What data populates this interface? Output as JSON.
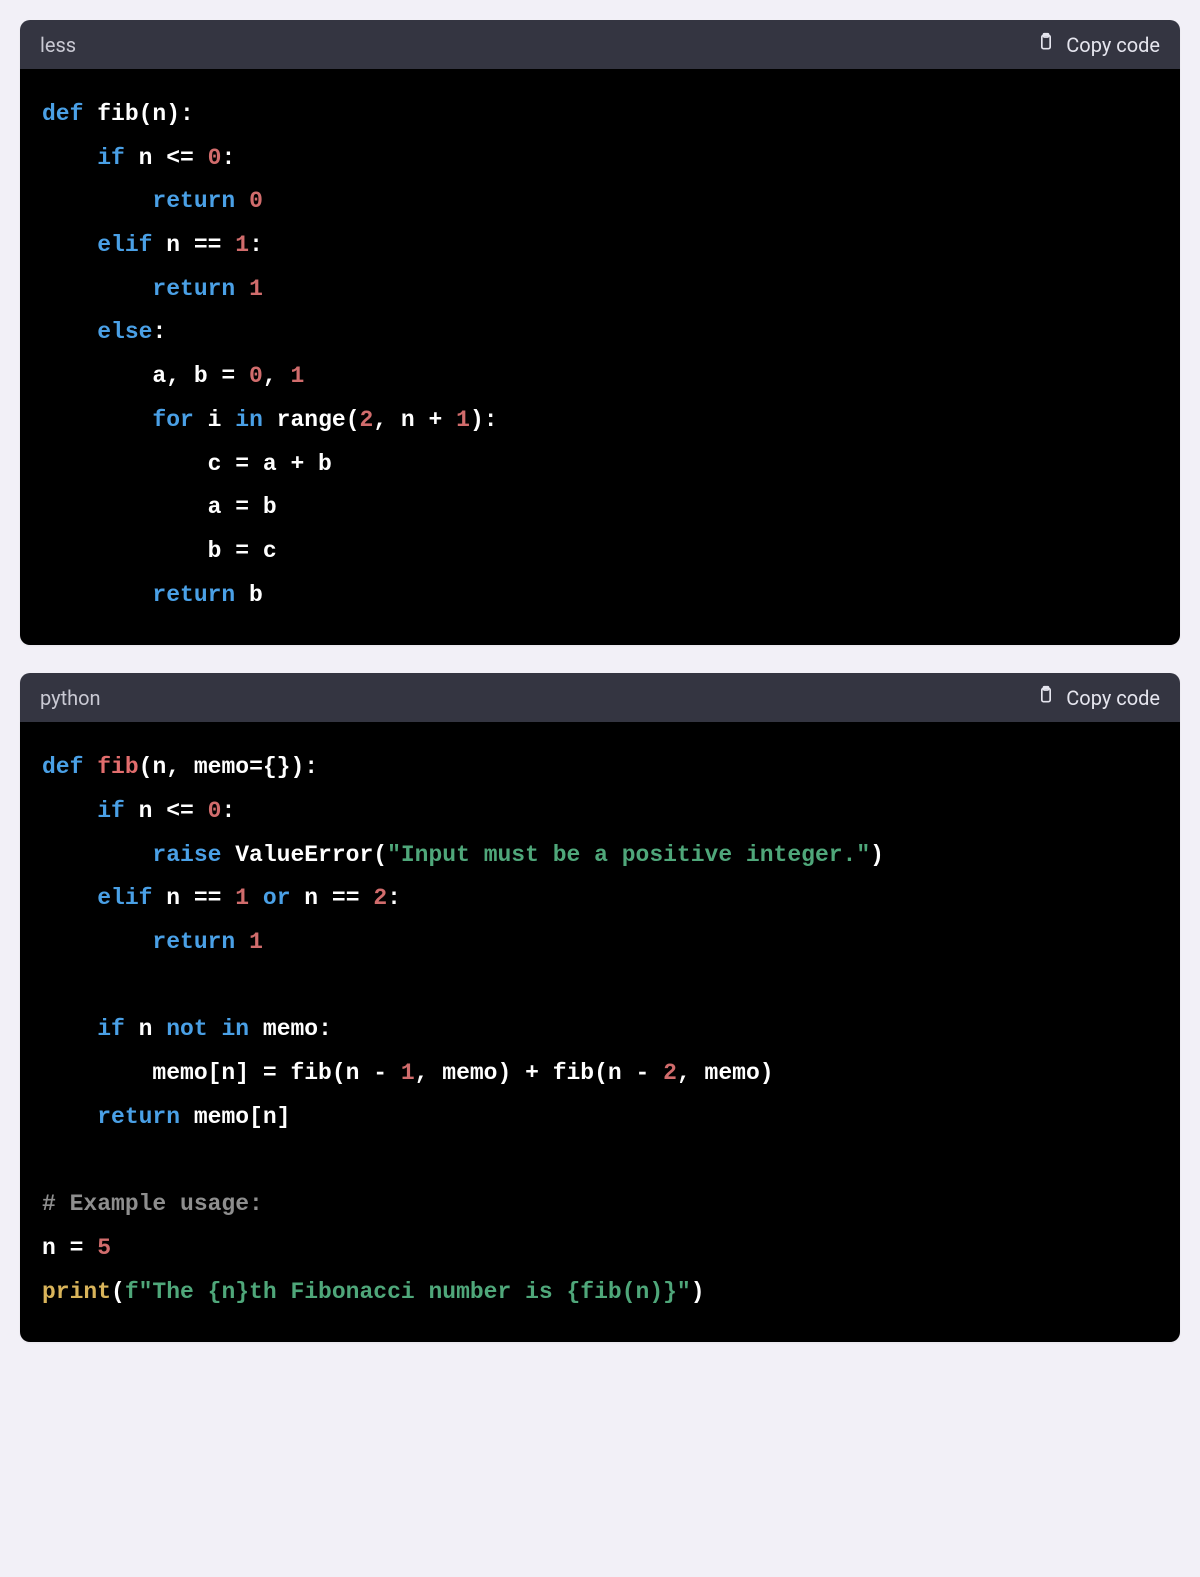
{
  "blocks": [
    {
      "language": "less",
      "copy_label": "Copy code",
      "code_tokens": [
        [
          {
            "c": "kw",
            "t": "def"
          },
          {
            "c": "plain",
            "t": " fib(n):"
          }
        ],
        [
          {
            "c": "plain",
            "t": "    "
          },
          {
            "c": "kw",
            "t": "if"
          },
          {
            "c": "plain",
            "t": " n <= "
          },
          {
            "c": "num",
            "t": "0"
          },
          {
            "c": "plain",
            "t": ":"
          }
        ],
        [
          {
            "c": "plain",
            "t": "        "
          },
          {
            "c": "kw",
            "t": "return"
          },
          {
            "c": "plain",
            "t": " "
          },
          {
            "c": "num",
            "t": "0"
          }
        ],
        [
          {
            "c": "plain",
            "t": "    "
          },
          {
            "c": "kw",
            "t": "elif"
          },
          {
            "c": "plain",
            "t": " n == "
          },
          {
            "c": "num",
            "t": "1"
          },
          {
            "c": "plain",
            "t": ":"
          }
        ],
        [
          {
            "c": "plain",
            "t": "        "
          },
          {
            "c": "kw",
            "t": "return"
          },
          {
            "c": "plain",
            "t": " "
          },
          {
            "c": "num",
            "t": "1"
          }
        ],
        [
          {
            "c": "plain",
            "t": "    "
          },
          {
            "c": "kw",
            "t": "else"
          },
          {
            "c": "plain",
            "t": ":"
          }
        ],
        [
          {
            "c": "plain",
            "t": "        a, b = "
          },
          {
            "c": "num",
            "t": "0"
          },
          {
            "c": "plain",
            "t": ", "
          },
          {
            "c": "num",
            "t": "1"
          }
        ],
        [
          {
            "c": "plain",
            "t": "        "
          },
          {
            "c": "kw",
            "t": "for"
          },
          {
            "c": "plain",
            "t": " i "
          },
          {
            "c": "kw",
            "t": "in"
          },
          {
            "c": "plain",
            "t": " range("
          },
          {
            "c": "num",
            "t": "2"
          },
          {
            "c": "plain",
            "t": ", n + "
          },
          {
            "c": "num",
            "t": "1"
          },
          {
            "c": "plain",
            "t": "):"
          }
        ],
        [
          {
            "c": "plain",
            "t": "            c = a + b"
          }
        ],
        [
          {
            "c": "plain",
            "t": "            a = b"
          }
        ],
        [
          {
            "c": "plain",
            "t": "            b = c"
          }
        ],
        [
          {
            "c": "plain",
            "t": "        "
          },
          {
            "c": "kw",
            "t": "return"
          },
          {
            "c": "plain",
            "t": " b"
          }
        ]
      ]
    },
    {
      "language": "python",
      "copy_label": "Copy code",
      "code_tokens": [
        [
          {
            "c": "kw",
            "t": "def"
          },
          {
            "c": "plain",
            "t": " "
          },
          {
            "c": "fn",
            "t": "fib"
          },
          {
            "c": "plain",
            "t": "(n, memo={}):"
          }
        ],
        [
          {
            "c": "plain",
            "t": "    "
          },
          {
            "c": "kw",
            "t": "if"
          },
          {
            "c": "plain",
            "t": " n <= "
          },
          {
            "c": "num",
            "t": "0"
          },
          {
            "c": "plain",
            "t": ":"
          }
        ],
        [
          {
            "c": "plain",
            "t": "        "
          },
          {
            "c": "kw",
            "t": "raise"
          },
          {
            "c": "plain",
            "t": " ValueError("
          },
          {
            "c": "str",
            "t": "\"Input must be a positive integer.\""
          },
          {
            "c": "plain",
            "t": ")"
          }
        ],
        [
          {
            "c": "plain",
            "t": "    "
          },
          {
            "c": "kw",
            "t": "elif"
          },
          {
            "c": "plain",
            "t": " n == "
          },
          {
            "c": "num",
            "t": "1"
          },
          {
            "c": "plain",
            "t": " "
          },
          {
            "c": "kw",
            "t": "or"
          },
          {
            "c": "plain",
            "t": " n == "
          },
          {
            "c": "num",
            "t": "2"
          },
          {
            "c": "plain",
            "t": ":"
          }
        ],
        [
          {
            "c": "plain",
            "t": "        "
          },
          {
            "c": "kw",
            "t": "return"
          },
          {
            "c": "plain",
            "t": " "
          },
          {
            "c": "num",
            "t": "1"
          }
        ],
        [
          {
            "c": "plain",
            "t": ""
          }
        ],
        [
          {
            "c": "plain",
            "t": "    "
          },
          {
            "c": "kw",
            "t": "if"
          },
          {
            "c": "plain",
            "t": " n "
          },
          {
            "c": "kw",
            "t": "not"
          },
          {
            "c": "plain",
            "t": " "
          },
          {
            "c": "kw",
            "t": "in"
          },
          {
            "c": "plain",
            "t": " memo:"
          }
        ],
        [
          {
            "c": "plain",
            "t": "        memo[n] = fib(n - "
          },
          {
            "c": "num",
            "t": "1"
          },
          {
            "c": "plain",
            "t": ", memo) + fib(n - "
          },
          {
            "c": "num",
            "t": "2"
          },
          {
            "c": "plain",
            "t": ", memo)"
          }
        ],
        [
          {
            "c": "plain",
            "t": "    "
          },
          {
            "c": "kw",
            "t": "return"
          },
          {
            "c": "plain",
            "t": " memo[n]"
          }
        ],
        [
          {
            "c": "plain",
            "t": ""
          }
        ],
        [
          {
            "c": "comment",
            "t": "# Example usage:"
          }
        ],
        [
          {
            "c": "plain",
            "t": "n = "
          },
          {
            "c": "num",
            "t": "5"
          }
        ],
        [
          {
            "c": "builtin",
            "t": "print"
          },
          {
            "c": "plain",
            "t": "("
          },
          {
            "c": "str",
            "t": "f\"The {n}th Fibonacci number is {fib(n)}\""
          },
          {
            "c": "plain",
            "t": ")"
          }
        ]
      ]
    }
  ]
}
